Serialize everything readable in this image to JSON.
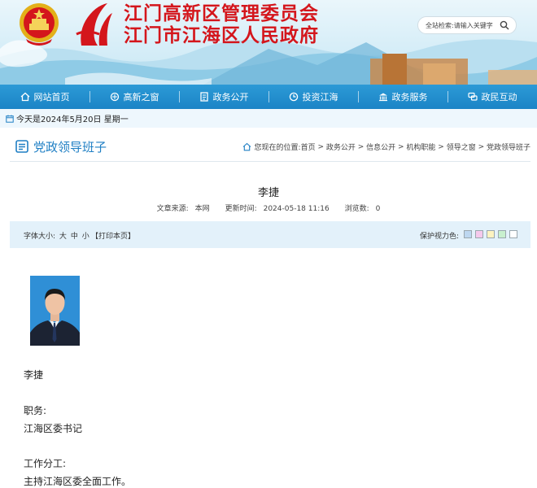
{
  "header": {
    "title_line1": "江门高新区管理委员会",
    "title_line2": "江门市江海区人民政府",
    "search_placeholder": "全站检索:请输入关键字"
  },
  "nav": {
    "items": [
      {
        "label": "网站首页",
        "icon": "house-icon"
      },
      {
        "label": "高新之窗",
        "icon": "window-icon"
      },
      {
        "label": "政务公开",
        "icon": "document-icon"
      },
      {
        "label": "投资江海",
        "icon": "clock-icon"
      },
      {
        "label": "政务服务",
        "icon": "government-building-icon"
      },
      {
        "label": "政民互动",
        "icon": "chat-bubbles-icon"
      }
    ]
  },
  "datebar": {
    "text": "今天是2024年5月20日 星期一"
  },
  "column": {
    "title": "党政领导班子",
    "breadcrumb_prefix": "您现在的位置:",
    "breadcrumb": [
      "首页",
      "政务公开",
      "信息公开",
      "机构职能",
      "领导之窗",
      "党政领导班子"
    ]
  },
  "article": {
    "title": "李捷",
    "source_label": "文章来源:",
    "source": "本网",
    "updated_label": "更新时间:",
    "updated": "2024-05-18 11:16",
    "views_label": "浏览数:",
    "views": "0",
    "fontsize_label": "字体大小:",
    "fontsize_large": "大",
    "fontsize_medium": "中",
    "fontsize_small": "小",
    "print_label": "【打印本页】",
    "eye_protect_label": "保护视力色:",
    "eye_colors": [
      "#bdd7f0",
      "#f5c9ec",
      "#fdf3c0",
      "#c8f0ce",
      "#ffffff"
    ],
    "name": "李捷",
    "position_label": "职务:",
    "position": "江海区委书记",
    "duty_label": "工作分工:",
    "duty": "主持江海区委全面工作。"
  },
  "colors": {
    "nav_blue": "#1b84c6",
    "title_red": "#d4161c",
    "column_blue": "#1f7fc4"
  }
}
